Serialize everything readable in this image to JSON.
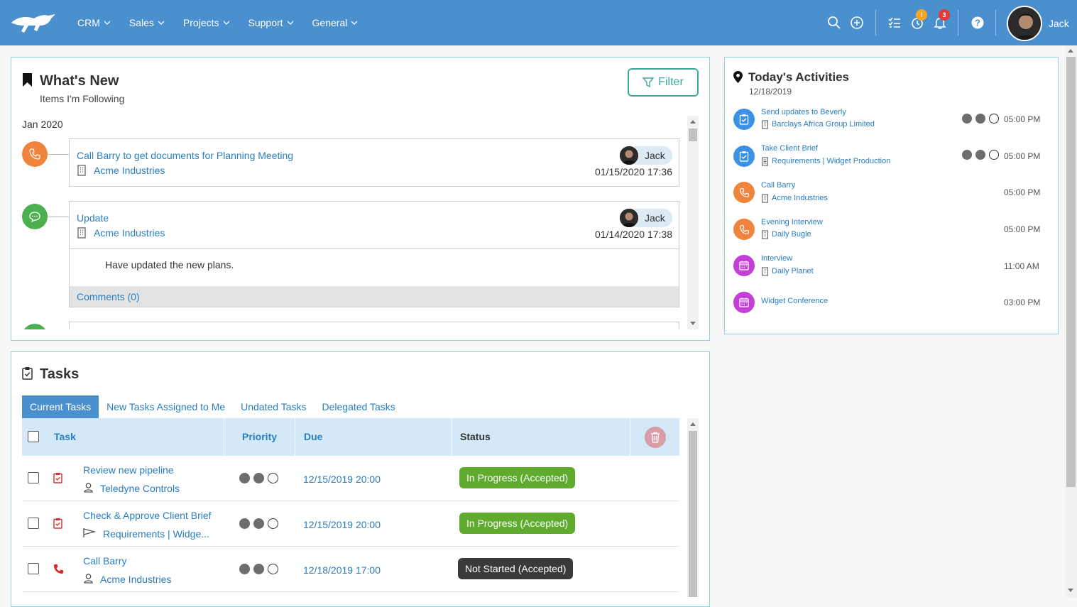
{
  "header": {
    "nav": [
      "CRM",
      "Sales",
      "Projects",
      "Support",
      "General"
    ],
    "badges": {
      "reminders": "!",
      "notifications": "3"
    },
    "user": "Jack"
  },
  "whats_new": {
    "title": "What's New",
    "subtitle": "Items I'm Following",
    "filter_label": "Filter",
    "month": "Jan 2020",
    "items": [
      {
        "title": "Call Barry to get documents for Planning Meeting",
        "company": "Acme Industries",
        "user": "Jack",
        "date": "01/15/2020 17:36",
        "icon": "phone-icon"
      },
      {
        "title": "Update",
        "company": "Acme Industries",
        "user": "Jack",
        "date": "01/14/2020 17:38",
        "body": "Have updated the new plans.",
        "comments": "Comments (0)",
        "icon": "chat-icon"
      }
    ]
  },
  "activities": {
    "title": "Today's Activities",
    "date": "12/18/2019",
    "items": [
      {
        "title": "Send updates to Beverly",
        "sub": "Barclays Africa Group Limited",
        "time": "05:00 PM",
        "type": "task",
        "priority": 2
      },
      {
        "title": "Take Client Brief",
        "sub": "Requirements | Widget Production",
        "time": "05:00 PM",
        "type": "task",
        "priority": 2
      },
      {
        "title": "Call Barry",
        "sub": "Acme Industries",
        "time": "05:00 PM",
        "type": "call"
      },
      {
        "title": "Evening Interview",
        "sub": "Daily Bugle",
        "time": "05:00 PM",
        "type": "call"
      },
      {
        "title": "Interview",
        "sub": "Daily Planet",
        "time": "11:00 AM",
        "type": "meeting"
      },
      {
        "title": "Widget Conference",
        "sub": "",
        "time": "03:00 PM",
        "type": "meeting"
      }
    ]
  },
  "tasks": {
    "title": "Tasks",
    "tabs": [
      "Current Tasks",
      "New Tasks Assigned to Me",
      "Undated Tasks",
      "Delegated Tasks"
    ],
    "columns": {
      "task": "Task",
      "priority": "Priority",
      "due": "Due",
      "status": "Status"
    },
    "rows": [
      {
        "title": "Review new pipeline",
        "sub": "Teledyne Controls",
        "due": "12/15/2019 20:00",
        "status": "In Progress (Accepted)",
        "priority": 2
      },
      {
        "title": "Check & Approve Client Brief",
        "sub": "Requirements | Widge...",
        "due": "12/15/2019 20:00",
        "status": "In Progress (Accepted)",
        "priority": 2
      },
      {
        "title": "Call Barry",
        "sub": "Acme Industries",
        "due": "12/18/2019 17:00",
        "status": "Not Started (Accepted)",
        "priority": 2
      }
    ]
  },
  "colors": {
    "header": "#4a8fce",
    "in_progress": "#5eab2e",
    "not_started": "#3a3a3a",
    "call": "#f0843c",
    "task": "#3a91e6",
    "meeting": "#c33fd6",
    "chat": "#4caf50"
  }
}
